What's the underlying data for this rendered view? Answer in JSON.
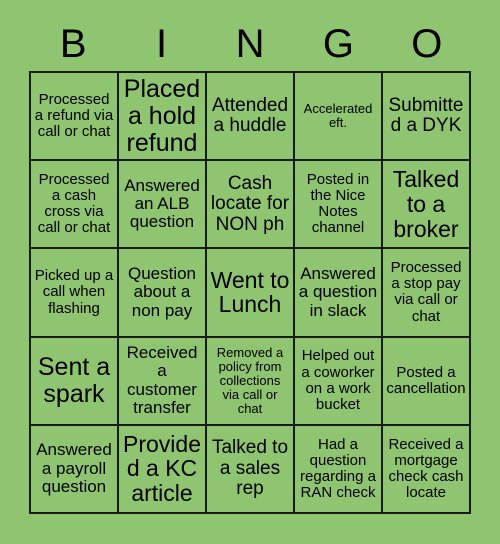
{
  "page": {
    "title": "BINGO",
    "background_color": "#8fc470",
    "border_color": "#1a1a1a",
    "text_color": "#000000"
  },
  "header": {
    "letters": [
      "B",
      "I",
      "N",
      "G",
      "O"
    ]
  },
  "grid": {
    "columns": 5,
    "rows": 5,
    "cells": [
      {
        "text": "Processed a refund via call or chat",
        "size": "sm"
      },
      {
        "text": "Placed a hold refund",
        "size": "xxl"
      },
      {
        "text": "Attended a huddle",
        "size": "lg"
      },
      {
        "text": "Accelerated eft.",
        "size": "xs"
      },
      {
        "text": "Submitted a DYK",
        "size": "lg"
      },
      {
        "text": "Processed a cash cross via call or chat",
        "size": "sm"
      },
      {
        "text": "Answered an ALB question",
        "size": "md"
      },
      {
        "text": "Cash locate for NON ph",
        "size": "lg"
      },
      {
        "text": "Posted in the Nice Notes channel",
        "size": "sm"
      },
      {
        "text": "Talked to a broker",
        "size": "xl"
      },
      {
        "text": "Picked up a call when flashing",
        "size": "sm"
      },
      {
        "text": "Question about a non pay",
        "size": "md"
      },
      {
        "text": "Went to Lunch",
        "size": "xl"
      },
      {
        "text": "Answered a question in slack",
        "size": "md"
      },
      {
        "text": "Processed a stop pay via call or chat",
        "size": "sm"
      },
      {
        "text": "Sent a spark",
        "size": "xxl"
      },
      {
        "text": "Received a customer transfer",
        "size": "md"
      },
      {
        "text": "Removed a policy from collections via call or chat",
        "size": "xs"
      },
      {
        "text": "Helped out a coworker on a work bucket",
        "size": "sm"
      },
      {
        "text": "Posted a cancellation",
        "size": "sm"
      },
      {
        "text": "Answered a payroll question",
        "size": "md"
      },
      {
        "text": "Provided a KC article",
        "size": "xl"
      },
      {
        "text": "Talked to a sales rep",
        "size": "lg"
      },
      {
        "text": "Had a question regarding a RAN check",
        "size": "sm"
      },
      {
        "text": "Received a mortgage check cash locate",
        "size": "sm"
      }
    ]
  }
}
